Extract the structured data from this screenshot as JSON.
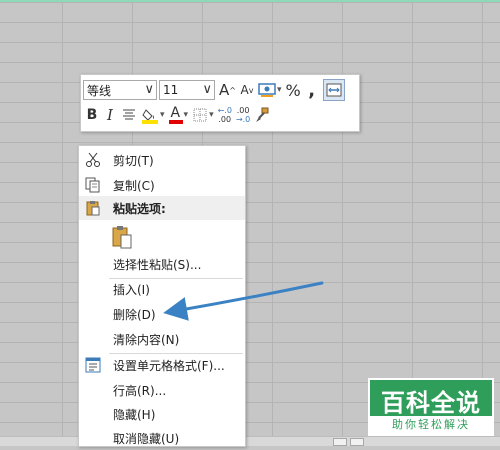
{
  "mini_toolbar": {
    "font_name": "等线",
    "font_size": "11",
    "grow_font": "A",
    "shrink_font": "A",
    "percent": "%",
    "comma": ",",
    "bold": "B",
    "italic": "I",
    "font_color_letter": "A",
    "dec_inc_top": "←.0",
    "dec_inc_bot": ".00",
    "dec_dec_top": ".00",
    "dec_dec_bot": "→.0"
  },
  "context_menu": {
    "items": [
      {
        "label": "剪切(T)",
        "icon": "scissors-icon"
      },
      {
        "label": "复制(C)",
        "icon": "copy-icon"
      },
      {
        "label": "粘贴选项:",
        "icon": "clipboard-icon"
      },
      {
        "label": "选择性粘贴(S)...",
        "icon": ""
      },
      {
        "label": "插入(I)",
        "icon": ""
      },
      {
        "label": "删除(D)",
        "icon": ""
      },
      {
        "label": "清除内容(N)",
        "icon": ""
      },
      {
        "label": "设置单元格格式(F)...",
        "icon": "format-cells-icon"
      },
      {
        "label": "行高(R)...",
        "icon": ""
      },
      {
        "label": "隐藏(H)",
        "icon": ""
      },
      {
        "label": "取消隐藏(U)",
        "icon": ""
      }
    ]
  },
  "watermark": {
    "title": "百科全说",
    "subtitle": "助你轻松解决"
  },
  "colors": {
    "arrow": "#3b82c4",
    "highlight_fill": "#ffe100",
    "font_color_bar": "#e00000",
    "watermark_bg": "#2f9e5a"
  }
}
